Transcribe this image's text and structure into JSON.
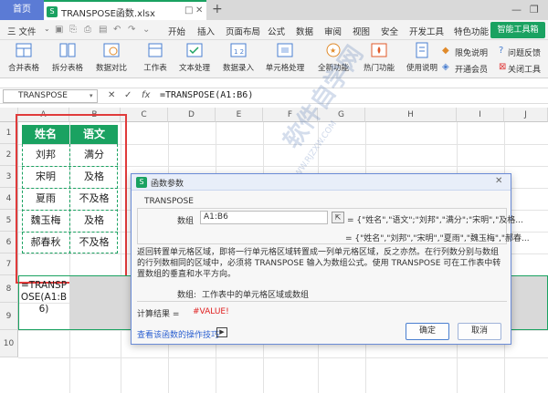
{
  "titlebar": {
    "home_tab": "首页",
    "file_tab": "TRANSPOSE函数.xlsx",
    "file_icon": "S",
    "add_tab": "+"
  },
  "menu": {
    "file_label": "三 文件",
    "items": [
      "开始",
      "插入",
      "页面布局",
      "公式",
      "数据",
      "审阅",
      "视图",
      "安全",
      "开发工具",
      "特色功能"
    ],
    "smart_button": "智能工具箱"
  },
  "ribbon": {
    "buttons": [
      "合并表格",
      "拆分表格",
      "数据对比",
      "工作表",
      "文本处理",
      "数据录入",
      "单元格处理",
      "全新功能",
      "热门功能",
      "使用说明"
    ],
    "side": {
      "limited_free": "限免说明",
      "open_member": "开通会员",
      "help": "问题反馈",
      "close_tool": "关闭工具"
    }
  },
  "formula_bar": {
    "name_box": "TRANSPOSE",
    "formula": "=TRANSPOSE(A1:B6)",
    "fx": "fx"
  },
  "columns": [
    "A",
    "B",
    "C",
    "D",
    "E",
    "F",
    "G",
    "H",
    "I",
    "J"
  ],
  "rows": [
    "1",
    "2",
    "3",
    "4",
    "5",
    "6",
    "7",
    "8",
    "9",
    "10"
  ],
  "table": {
    "headers": [
      "姓名",
      "语文"
    ],
    "rows": [
      [
        "刘邦",
        "满分"
      ],
      [
        "宋明",
        "及格"
      ],
      [
        "夏雨",
        "不及格"
      ],
      [
        "魏玉梅",
        "及格"
      ],
      [
        "郝春秋",
        "不及格"
      ]
    ]
  },
  "edit_cell": "=TRANSPOSE(A1:B6)",
  "watermark": "软件自学网",
  "watermark_url": "WWW.RJZXW.COM",
  "dialog": {
    "title": "函数参数",
    "func_name": "TRANSPOSE",
    "arg_label": "数组",
    "arg_value": "A1:B6",
    "arg_preview": "= {\"姓名\",\"语文\";\"刘邦\",\"满分\";\"宋明\",\"及格...",
    "result_preview": "= {\"姓名\",\"刘邦\",\"宋明\",\"夏雨\",\"魏玉梅\",\"郝春...",
    "description": "返回转置单元格区域，即将一行单元格区域转置成一列单元格区域，反之亦然。在行列数分别与数组的行列数相同的区域中，必须将 TRANSPOSE 输入为数组公式。使用 TRANSPOSE 可在工作表中转置数组的垂直和水平方向。",
    "arg_desc_label": "数组:",
    "arg_desc": "工作表中的单元格区域或数组",
    "result_label": "计算结果 =",
    "result_value": "#VALUE!",
    "help_link": "查看该函数的操作技巧",
    "ok": "确定",
    "cancel": "取消"
  },
  "colors": {
    "accent_green": "#1aa261",
    "header_blue": "#5b7bd5",
    "red_box": "#e03b3b",
    "error_red": "#e02020"
  }
}
